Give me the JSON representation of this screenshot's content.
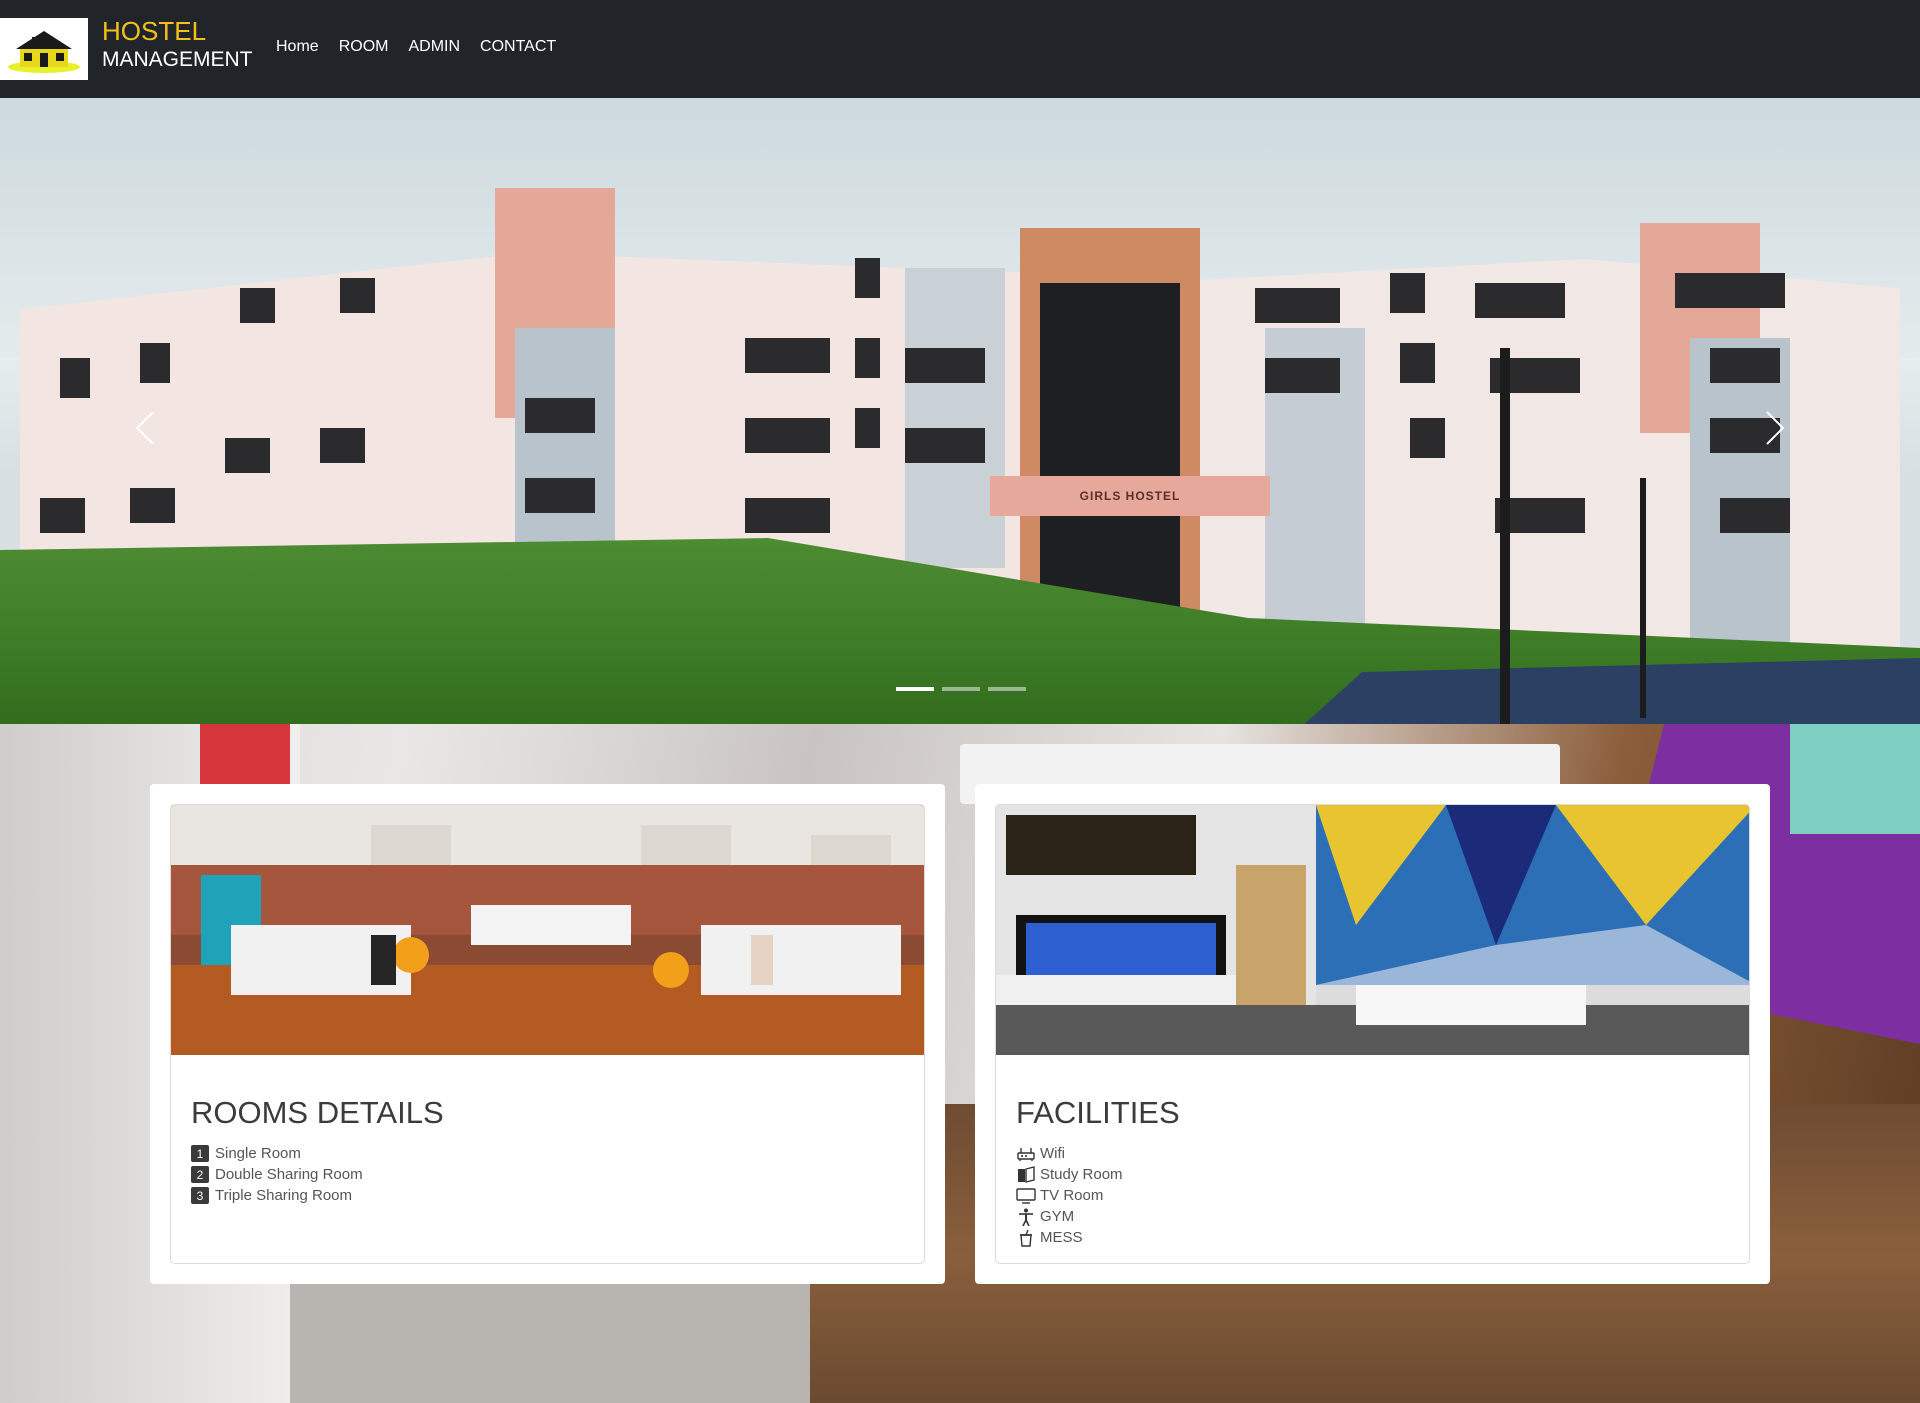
{
  "navbar": {
    "brand_line1": "HOSTEL",
    "brand_line2": "MANAGEMENT",
    "logo_icon": "house-logo-icon",
    "links": [
      {
        "label": "Home"
      },
      {
        "label": "ROOM"
      },
      {
        "label": "ADMIN"
      },
      {
        "label": "CONTACT"
      }
    ],
    "bg_color": "#212529",
    "brand_accent": "#f2c21b"
  },
  "hero": {
    "sign_text": "GIRLS HOSTEL",
    "prev_icon": "chevron-left-icon",
    "next_icon": "chevron-right-icon",
    "slides_count": 3,
    "active_slide": 1
  },
  "rooms_card": {
    "title": "ROOMS DETAILS",
    "items": [
      {
        "badge": "1",
        "label": "Single Room"
      },
      {
        "badge": "2",
        "label": "Double Sharing Room"
      },
      {
        "badge": "3",
        "label": "Triple Sharing Room"
      }
    ]
  },
  "facilities_card": {
    "title": "FACILITIES",
    "items": [
      {
        "icon": "router-icon",
        "label": "Wifi"
      },
      {
        "icon": "book-icon",
        "label": "Study Room"
      },
      {
        "icon": "tv-icon",
        "label": "TV Room"
      },
      {
        "icon": "person-icon",
        "label": "GYM"
      },
      {
        "icon": "cup-icon",
        "label": "MESS"
      }
    ]
  }
}
